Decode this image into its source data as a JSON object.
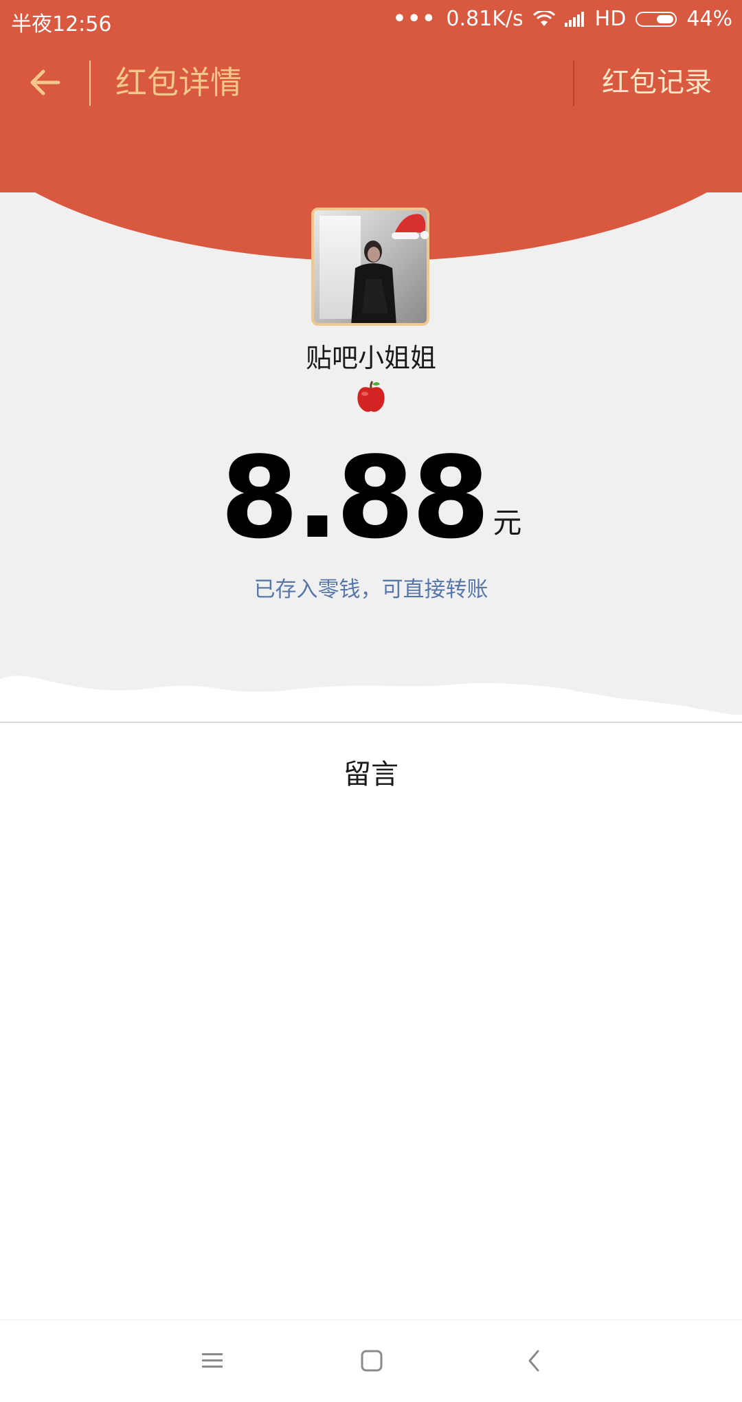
{
  "status_bar": {
    "time": "半夜12:56",
    "dots": "•••",
    "network_speed": "0.81K/s",
    "network_type": "HD",
    "battery_percent": "44%"
  },
  "nav": {
    "title": "红包详情",
    "records_label": "红包记录",
    "back_icon": "arrow-left-icon"
  },
  "red_packet": {
    "sender_name": "贴吧小姐姐",
    "amount": "8.88",
    "unit": "元",
    "saved_text": "已存入零钱，可直接转账"
  },
  "message_section": {
    "label": "留言"
  },
  "colors": {
    "header_red": "#d95840",
    "title_gold": "#f1c78b",
    "link_blue": "#5677a8",
    "background": "#f0f0f0"
  },
  "icons": {
    "avatar": "avatar-photo",
    "hat": "santa-hat-icon",
    "apple": "apple-emoji-icon",
    "system_nav": [
      "menu-icon",
      "home-icon",
      "back-icon"
    ]
  }
}
